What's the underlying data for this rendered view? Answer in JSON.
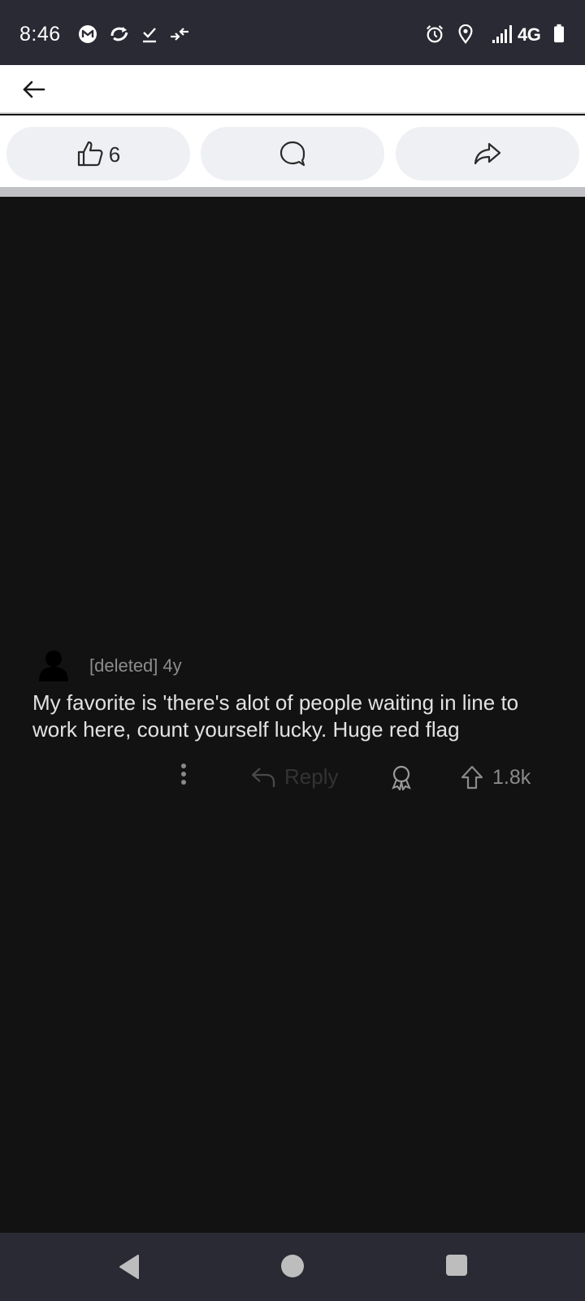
{
  "status_bar": {
    "time": "8:46",
    "network": "4G",
    "icons": [
      "messenger-icon",
      "sync-icon",
      "download-done-icon",
      "data-transfer-icon",
      "alarm-icon",
      "location-icon",
      "signal-icon",
      "battery-icon"
    ]
  },
  "header": {
    "back_icon": "arrow-left-icon"
  },
  "actions": {
    "like_count": "6",
    "like_icon": "thumbs-up-icon",
    "comment_icon": "comment-bubble-icon",
    "share_icon": "share-arrow-icon"
  },
  "comment": {
    "author": "[deleted]",
    "age": "4y",
    "body": "My favorite is 'there's alot of people waiting in line to work here, count yourself lucky. Huge red flag",
    "reply_label": "Reply",
    "vote_count": "1.8k"
  },
  "colors": {
    "status_bar_bg": "#2a2a34",
    "page_bg": "#121212",
    "pill_bg": "#eff0f3",
    "comment_text": "#e2e2e2",
    "meta_text": "#8c8c8c"
  },
  "nav": {
    "items": [
      "back-triangle-icon",
      "home-circle-icon",
      "recents-square-icon"
    ]
  }
}
